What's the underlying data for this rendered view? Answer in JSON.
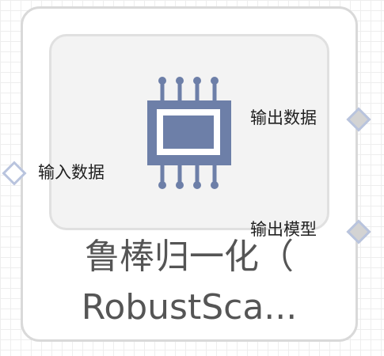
{
  "node": {
    "title_line1": "鲁棒归一化（",
    "title_line2": "RobustSca...",
    "icon": "chip-icon"
  },
  "ports": {
    "input_data_label": "输入数据",
    "output_data_label": "输出数据",
    "output_model_label": "输出模型"
  },
  "colors": {
    "icon": "#6d7fa8",
    "port_border": "#b9c4de",
    "node_border": "#d9d9d9",
    "inner_background": "#f3f3f3"
  }
}
